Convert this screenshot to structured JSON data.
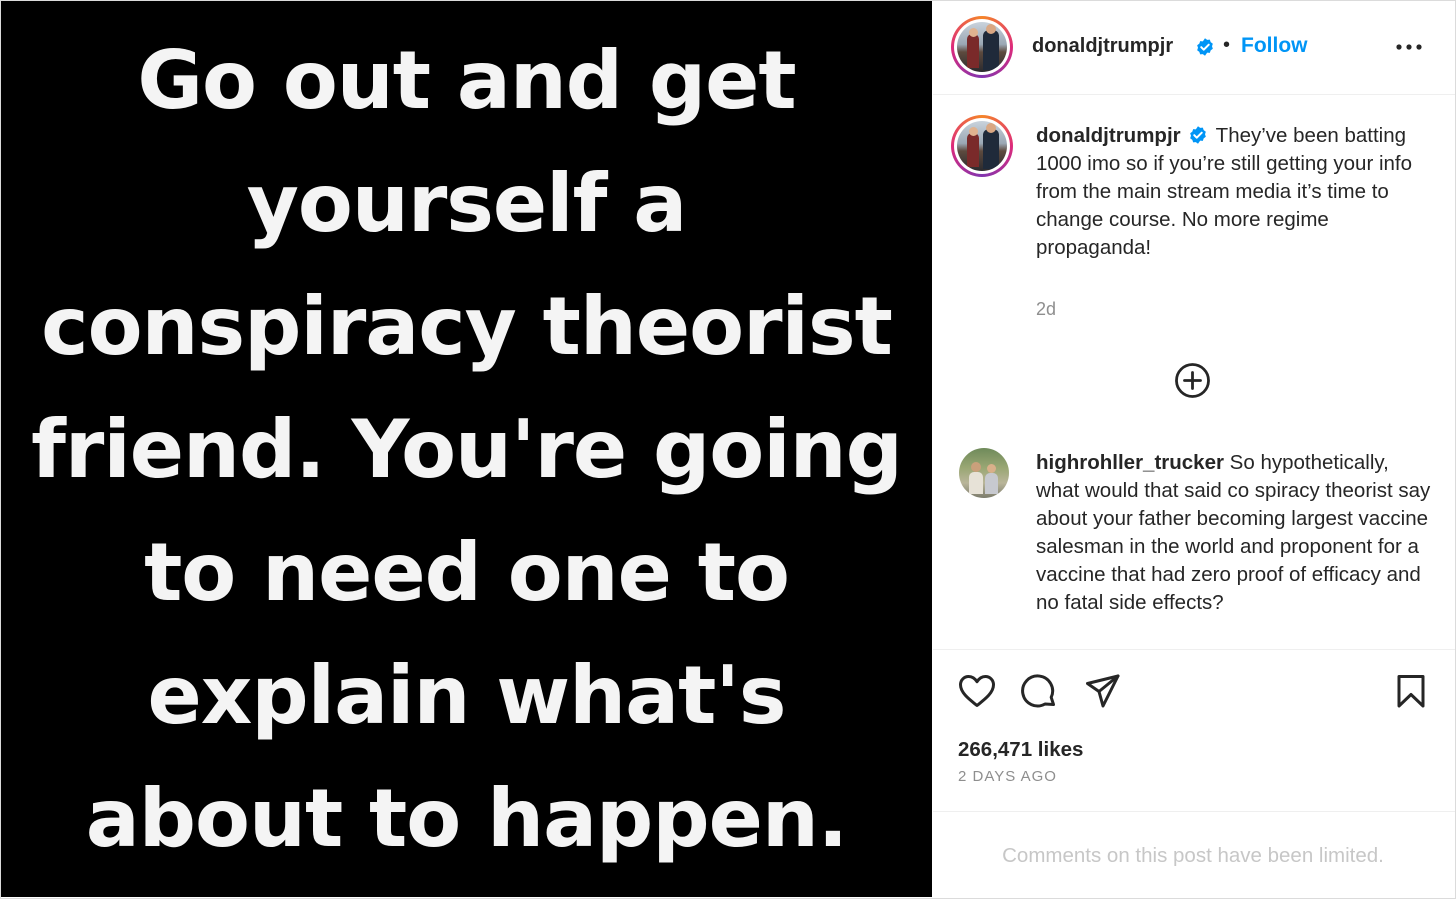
{
  "post": {
    "image_text_lines": [
      "Go out and get",
      "yourself a",
      "conspiracy theorist",
      "friend. You're going",
      "to need one to",
      "explain what's",
      "about to happen."
    ]
  },
  "header": {
    "username": "donaldjtrumpjr",
    "separator": "•",
    "follow_label": "Follow",
    "more_icon": "more-horizontal-icon"
  },
  "caption": {
    "username": "donaldjtrumpjr",
    "text": "They’ve been batting 1000 imo so if you’re still getting your info from the main stream media it’s time to change course. No more regime propaganda!",
    "time": "2d"
  },
  "load_more": {
    "icon": "plus-circle-icon"
  },
  "comment": {
    "username": "highrohller_trucker",
    "text": "So hypothetically, what would that said co spiracy theorist say about your father becoming largest vaccine salesman in the world and proponent for a vaccine that had zero proof of efficacy and no fatal side effects?"
  },
  "actions": {
    "like_icon": "heart-icon",
    "comment_icon": "comment-icon",
    "share_icon": "send-icon",
    "save_icon": "bookmark-icon"
  },
  "stats": {
    "likes": "266,471 likes",
    "date": "2 DAYS AGO"
  },
  "footer": {
    "limited_text": "Comments on this post have been limited."
  },
  "colors": {
    "accent": "#0095f6",
    "verified": "#0095f6",
    "muted": "#8e8e8e",
    "limited": "#c7c7c7"
  }
}
